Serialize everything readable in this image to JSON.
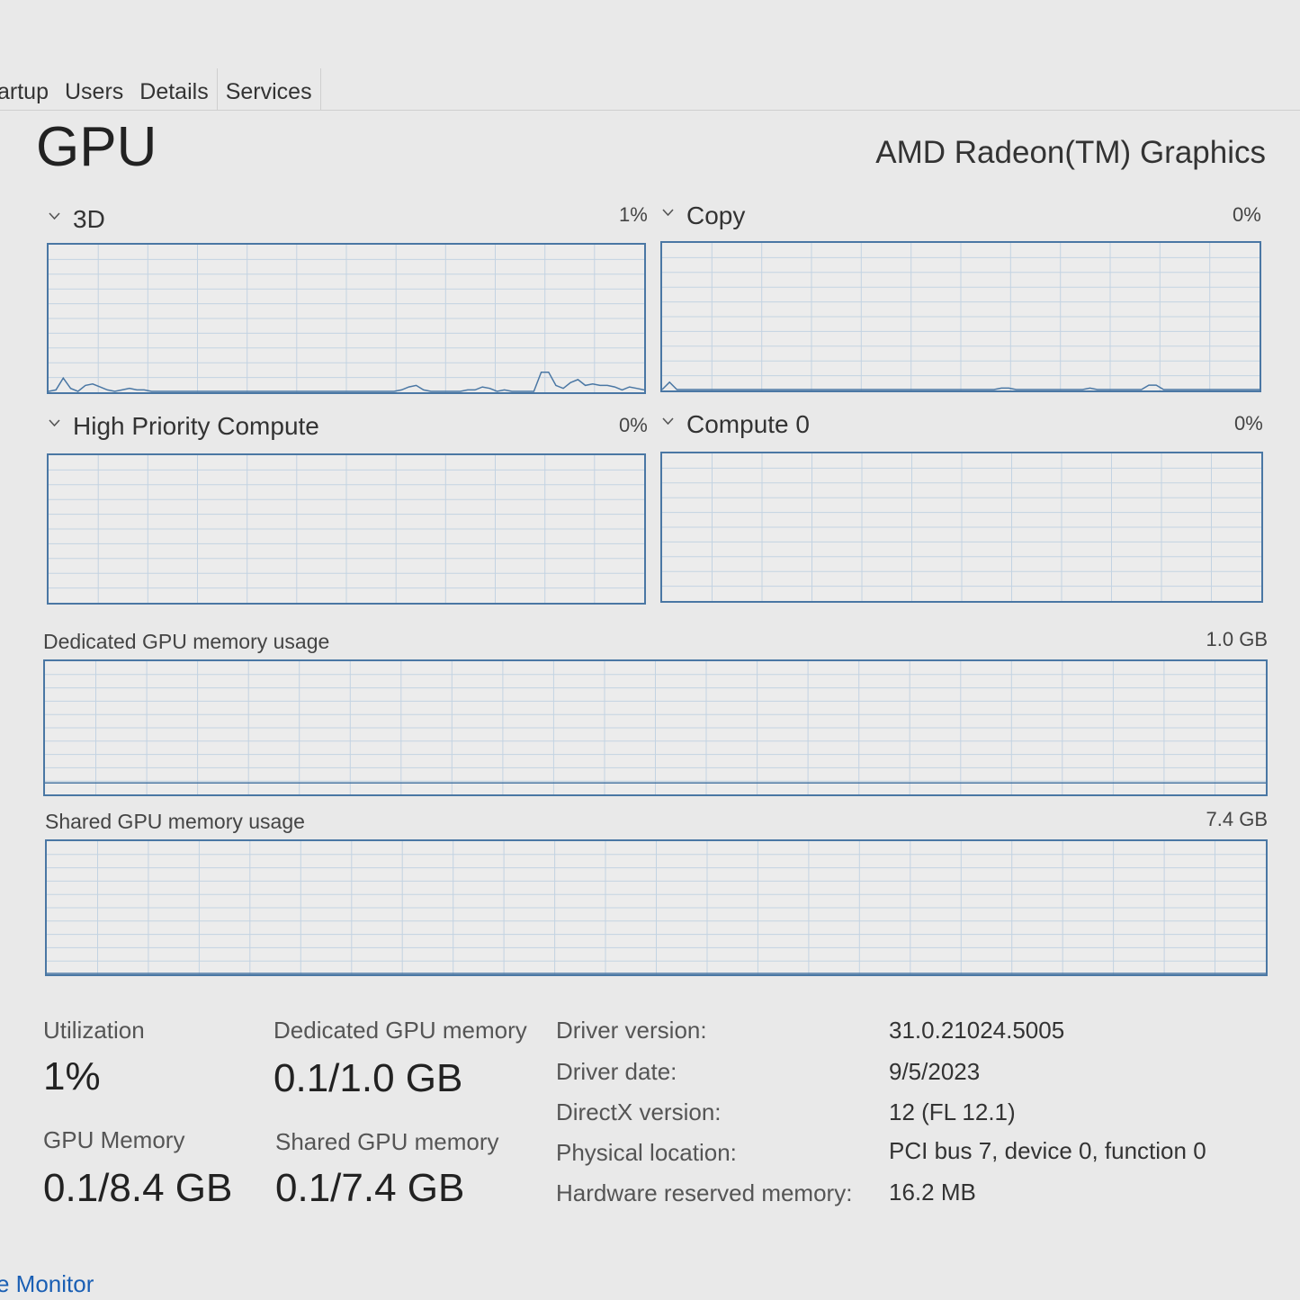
{
  "tabs": [
    "artup",
    "Users",
    "Details",
    "Services"
  ],
  "page_title": "GPU",
  "device_name": "AMD Radeon(TM) Graphics",
  "engines": [
    {
      "label": "3D",
      "percent": "1%",
      "samples": [
        0,
        1,
        9,
        2,
        0,
        4,
        5,
        3,
        1,
        0,
        1,
        2,
        1,
        1,
        0,
        0,
        0,
        0,
        0,
        0,
        0,
        0,
        0,
        0,
        0,
        0,
        0,
        0,
        0,
        0,
        0,
        0,
        0,
        0,
        0,
        0,
        0,
        0,
        0,
        0,
        0,
        0,
        0,
        0,
        0,
        0,
        0,
        0,
        1,
        3,
        4,
        1,
        0,
        0,
        0,
        0,
        0,
        1,
        1,
        3,
        2,
        0,
        1,
        0,
        0,
        0,
        0,
        13,
        13,
        4,
        2,
        6,
        8,
        4,
        5,
        4,
        4,
        3,
        1,
        3,
        2,
        1
      ]
    },
    {
      "label": "Copy",
      "percent": "0%",
      "samples": [
        0,
        5,
        0,
        0,
        0,
        0,
        0,
        0,
        0,
        0,
        0,
        0,
        0,
        0,
        0,
        0,
        0,
        0,
        0,
        0,
        0,
        0,
        0,
        0,
        0,
        0,
        0,
        0,
        0,
        0,
        0,
        0,
        0,
        0,
        0,
        0,
        0,
        0,
        0,
        0,
        0,
        0,
        0,
        0,
        0,
        0,
        1,
        1,
        0,
        0,
        0,
        0,
        0,
        0,
        0,
        0,
        0,
        0,
        1,
        0,
        0,
        0,
        0,
        0,
        0,
        0,
        3,
        3,
        0,
        0,
        0,
        0,
        0,
        0,
        0,
        0,
        0,
        0,
        0,
        0,
        0,
        0
      ]
    },
    {
      "label": "High Priority Compute",
      "percent": "0%",
      "samples": []
    },
    {
      "label": "Compute 0",
      "percent": "0%",
      "samples": []
    }
  ],
  "dedicated_memory_graph": {
    "label": "Dedicated GPU memory usage",
    "max": "1.0 GB",
    "level_fraction": 0.08
  },
  "shared_memory_graph": {
    "label": "Shared GPU memory usage",
    "max": "7.4 GB",
    "level_fraction": 0.0
  },
  "stats": {
    "utilization_label": "Utilization",
    "utilization_value": "1%",
    "dedicated_label": "Dedicated GPU memory",
    "dedicated_value": "0.1/1.0 GB",
    "gpu_memory_label": "GPU Memory",
    "gpu_memory_value": "0.1/8.4 GB",
    "shared_label": "Shared GPU memory",
    "shared_value": "0.1/7.4 GB"
  },
  "info": [
    {
      "label": "Driver version:",
      "value": "31.0.21024.5005"
    },
    {
      "label": "Driver date:",
      "value": "9/5/2023"
    },
    {
      "label": "DirectX version:",
      "value": "12 (FL 12.1)"
    },
    {
      "label": "Physical location:",
      "value": "PCI bus 7, device 0, function 0"
    },
    {
      "label": "Hardware reserved memory:",
      "value": "16.2 MB"
    }
  ],
  "footer_link": "e Monitor",
  "colors": {
    "graph_line": "#4a77a4",
    "grid": "#c3d3e2",
    "link": "#1a5fb4"
  }
}
